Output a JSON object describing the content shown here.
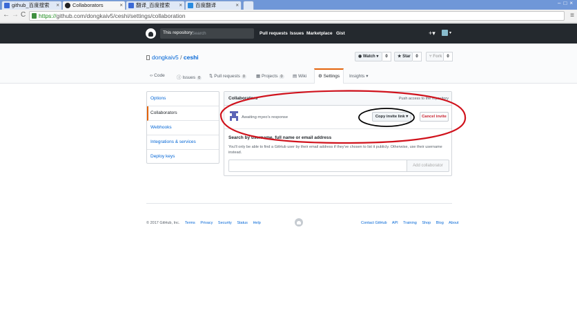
{
  "browser": {
    "tabs": [
      {
        "label": "github_百度搜索",
        "active": false
      },
      {
        "label": "Collaborators",
        "active": true
      },
      {
        "label": "翻译_百度搜索",
        "active": false
      },
      {
        "label": "百度翻译",
        "active": false
      }
    ],
    "url_scheme": "https://",
    "url_rest": "github.com/dongkaiv5/ceshi/settings/collaboration"
  },
  "header": {
    "scope_label": "This repository",
    "search_placeholder": "Search",
    "nav": [
      "Pull requests",
      "Issues",
      "Marketplace",
      "Gist"
    ]
  },
  "repo": {
    "owner": "dongkaiv5",
    "separator": "/",
    "name": "ceshi",
    "watch_label": "Watch ▾",
    "watch_count": "0",
    "star_label": "Star",
    "star_count": "0",
    "fork_label": "Fork",
    "fork_count": "0",
    "tabs": [
      {
        "label": "Code"
      },
      {
        "label": "Issues",
        "count": "0"
      },
      {
        "label": "Pull requests",
        "count": "0"
      },
      {
        "label": "Projects",
        "count": "0"
      },
      {
        "label": "Wiki"
      },
      {
        "label": "Settings"
      },
      {
        "label": "Insights ▾"
      }
    ]
  },
  "sidebar": {
    "items": [
      "Options",
      "Collaborators",
      "Webhooks",
      "Integrations & services",
      "Deploy keys"
    ]
  },
  "collaborators": {
    "title": "Collaborators",
    "note": "Push access to the repository",
    "awaiting": "Awaiting myeo's response",
    "copy_invite_label": "Copy invite link ▾",
    "cancel_invite_label": "Cancel invite",
    "search_label": "Search by username, full name or email address",
    "search_help": "You'll only be able to find a GitHub user by their email address if they've chosen to list it publicly. Otherwise, use their username instead.",
    "add_label": "Add collaborator"
  },
  "footer": {
    "copyright": "© 2017 GitHub, Inc.",
    "left_links": [
      "Terms",
      "Privacy",
      "Security",
      "Status",
      "Help"
    ],
    "right_links": [
      "Contact GitHub",
      "API",
      "Training",
      "Shop",
      "Blog",
      "About"
    ]
  },
  "colors": {
    "accent": "#e36209",
    "link": "#0366d6",
    "header_bg": "#24292e",
    "annotation_red": "#d0121c",
    "danger": "#cb2431"
  }
}
